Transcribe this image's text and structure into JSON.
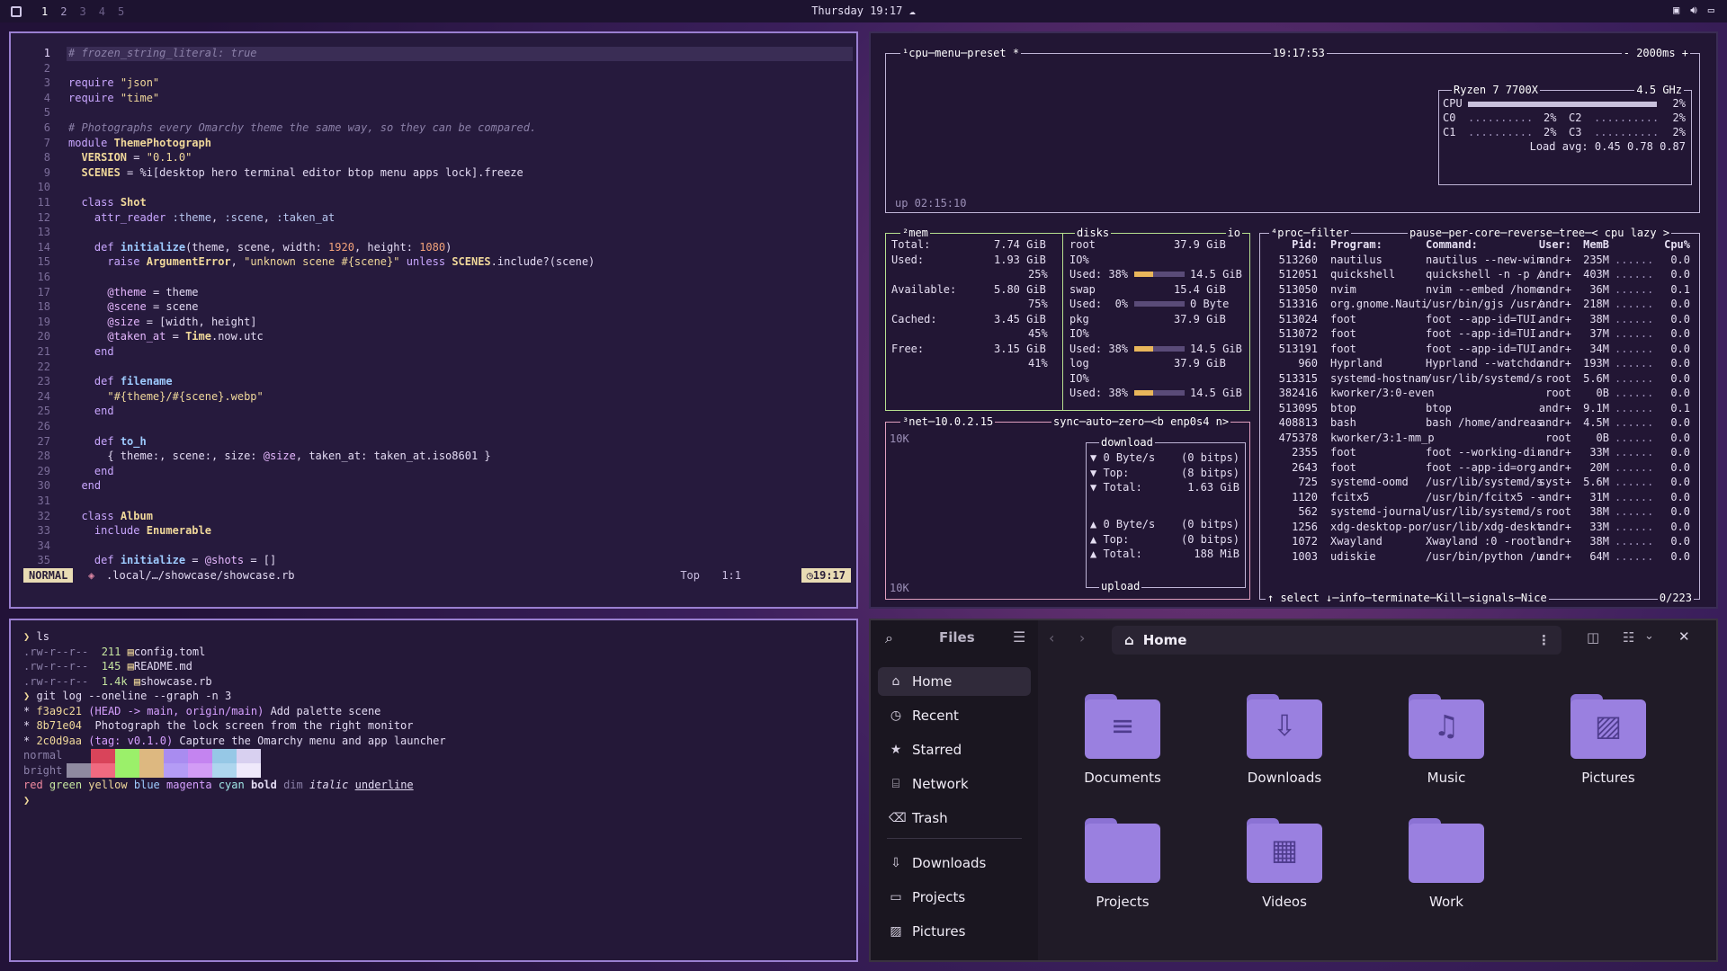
{
  "topbar": {
    "workspaces": [
      "1",
      "2",
      "3",
      "4",
      "5"
    ],
    "clock": "Thursday 19:17",
    "weather_icon": "cloud-icon",
    "tray_icons": [
      "screen-icon",
      "volume-icon",
      "display-icon"
    ]
  },
  "nvim": {
    "lines": [
      {
        "n": "1",
        "code": "# frozen_string_literal: true"
      },
      {
        "n": "2",
        "code": ""
      },
      {
        "n": "3",
        "code": "require \"json\""
      },
      {
        "n": "4",
        "code": "require \"time\""
      },
      {
        "n": "5",
        "code": ""
      },
      {
        "n": "6",
        "code": "# Photographs every Omarchy theme the same way, so they can be compared."
      },
      {
        "n": "7",
        "code": "module ThemePhotograph"
      },
      {
        "n": "8",
        "code": "  VERSION = \"0.1.0\""
      },
      {
        "n": "9",
        "code": "  SCENES = %i[desktop hero terminal editor btop menu apps lock].freeze"
      },
      {
        "n": "10",
        "code": ""
      },
      {
        "n": "11",
        "code": "  class Shot"
      },
      {
        "n": "12",
        "code": "    attr_reader :theme, :scene, :taken_at"
      },
      {
        "n": "13",
        "code": ""
      },
      {
        "n": "14",
        "code": "    def initialize(theme, scene, width: 1920, height: 1080)"
      },
      {
        "n": "15",
        "code": "      raise ArgumentError, \"unknown scene #{scene}\" unless SCENES.include?(scene)"
      },
      {
        "n": "16",
        "code": ""
      },
      {
        "n": "17",
        "code": "      @theme = theme"
      },
      {
        "n": "18",
        "code": "      @scene = scene"
      },
      {
        "n": "19",
        "code": "      @size = [width, height]"
      },
      {
        "n": "20",
        "code": "      @taken_at = Time.now.utc"
      },
      {
        "n": "21",
        "code": "    end"
      },
      {
        "n": "22",
        "code": ""
      },
      {
        "n": "23",
        "code": "    def filename"
      },
      {
        "n": "24",
        "code": "      \"#{theme}/#{scene}.webp\""
      },
      {
        "n": "25",
        "code": "    end"
      },
      {
        "n": "26",
        "code": ""
      },
      {
        "n": "27",
        "code": "    def to_h"
      },
      {
        "n": "28",
        "code": "      { theme:, scene:, size: @size, taken_at: taken_at.iso8601 }"
      },
      {
        "n": "29",
        "code": "    end"
      },
      {
        "n": "30",
        "code": "  end"
      },
      {
        "n": "31",
        "code": ""
      },
      {
        "n": "32",
        "code": "  class Album"
      },
      {
        "n": "33",
        "code": "    include Enumerable"
      },
      {
        "n": "34",
        "code": ""
      },
      {
        "n": "35",
        "code": "    def initialize = @shots = []"
      }
    ],
    "status": {
      "mode": "NORMAL",
      "file": ".local/…/showcase/showcase.rb",
      "scroll": "Top",
      "position": "1:1",
      "time": "19:17"
    }
  },
  "btop": {
    "cpu": {
      "title": "¹cpu",
      "menu": "menu",
      "preset": "preset *",
      "clock": "19:17:53",
      "interval": "- 2000ms +",
      "model": "Ryzen 7 7700X",
      "freq": "4.5 GHz",
      "rows": [
        {
          "label": "CPU",
          "val": "2%"
        },
        {
          "label": "C0",
          "val": "2%"
        },
        {
          "label": "C2",
          "val": "2%"
        },
        {
          "label": "C1",
          "val": "2%"
        },
        {
          "label": "C3",
          "val": "2%"
        }
      ],
      "load": "Load avg: 0.45 0.78 0.87",
      "uptime": "up 02:15:10"
    },
    "mem": {
      "title": "²mem",
      "rows": [
        {
          "label": "Total:",
          "val": "7.74 GiB"
        },
        {
          "label": "Used:",
          "val": "1.93 GiB",
          "pct": "25%"
        },
        {
          "label": "Available:",
          "val": "5.80 GiB",
          "pct": "75%"
        },
        {
          "label": "Cached:",
          "val": "3.45 GiB",
          "pct": "45%"
        },
        {
          "label": "Free:",
          "val": "3.15 GiB",
          "pct": "41%"
        }
      ]
    },
    "disks": {
      "title": "disks",
      "io": "io",
      "rows": [
        {
          "name": "root",
          "size": "37.9 GiB",
          "io": "IO%",
          "used": "Used: 38%",
          "usedval": "14.5 GiB",
          "fill": 0.38
        },
        {
          "name": "swap",
          "size": "15.4 GiB",
          "io": "",
          "used": "Used:  0%",
          "usedval": "0 Byte",
          "fill": 0.0
        },
        {
          "name": "pkg",
          "size": "37.9 GiB",
          "io": "IO%",
          "used": "Used: 38%",
          "usedval": "14.5 GiB",
          "fill": 0.38
        },
        {
          "name": "log",
          "size": "37.9 GiB",
          "io": "IO%",
          "used": "Used: 38%",
          "usedval": "14.5 GiB",
          "fill": 0.38
        }
      ]
    },
    "net": {
      "title": "³net",
      "ip": "10.0.2.15",
      "buttons": [
        "sync",
        "auto",
        "zero",
        "<b enp0s4 n>"
      ],
      "scale_top": "10K",
      "scale_bottom": "10K",
      "download": "download",
      "upload": "upload",
      "dl_rows": [
        {
          "k": "▼ 0 Byte/s",
          "v": "(0 bitps)"
        },
        {
          "k": "▼ Top:",
          "v": "(8 bitps)"
        },
        {
          "k": "▼ Total:",
          "v": "1.63 GiB"
        }
      ],
      "ul_rows": [
        {
          "k": "▲ 0 Byte/s",
          "v": "(0 bitps)"
        },
        {
          "k": "▲ Top:",
          "v": "(0 bitps)"
        },
        {
          "k": "▲ Total:",
          "v": "188 MiB"
        }
      ]
    },
    "proc": {
      "title": "⁴proc",
      "filter": "filter",
      "options": [
        "pause",
        "per-core",
        "reverse",
        "tree",
        "< cpu lazy >"
      ],
      "headers": [
        "Pid:",
        "Program:",
        "Command:",
        "User:",
        "MemB",
        "Cpu%"
      ],
      "rows": [
        [
          "513260",
          "nautilus",
          "nautilus --new-win",
          "andr+",
          "235M",
          "0.0"
        ],
        [
          "512051",
          "quickshell",
          "quickshell -n -p /",
          "andr+",
          "403M",
          "0.0"
        ],
        [
          "513050",
          "nvim",
          "nvim --embed /home",
          "andr+",
          "36M",
          "0.1"
        ],
        [
          "513316",
          "org.gnome.Nauti",
          "/usr/bin/gjs /usr/",
          "andr+",
          "218M",
          "0.0"
        ],
        [
          "513024",
          "foot",
          "foot --app-id=TUI.",
          "andr+",
          "38M",
          "0.0"
        ],
        [
          "513072",
          "foot",
          "foot --app-id=TUI.",
          "andr+",
          "37M",
          "0.0"
        ],
        [
          "513191",
          "foot",
          "foot --app-id=TUI.",
          "andr+",
          "34M",
          "0.0"
        ],
        [
          "960",
          "Hyprland",
          "Hyprland --watchdo",
          "andr+",
          "193M",
          "0.0"
        ],
        [
          "513315",
          "systemd-hostnam",
          "/usr/lib/systemd/s",
          "root",
          "5.6M",
          "0.0"
        ],
        [
          "382416",
          "kworker/3:0-even",
          "",
          "root",
          "0B",
          "0.0"
        ],
        [
          "513095",
          "btop",
          "btop",
          "andr+",
          "9.1M",
          "0.1"
        ],
        [
          "408813",
          "bash",
          "bash /home/andreas",
          "andr+",
          "4.5M",
          "0.0"
        ],
        [
          "475378",
          "kworker/3:1-mm_p",
          "",
          "root",
          "0B",
          "0.0"
        ],
        [
          "2355",
          "foot",
          "foot --working-dir",
          "andr+",
          "33M",
          "0.0"
        ],
        [
          "2643",
          "foot",
          "foot --app-id=org.",
          "andr+",
          "20M",
          "0.0"
        ],
        [
          "725",
          "systemd-oomd",
          "/usr/lib/systemd/s",
          "syst+",
          "5.6M",
          "0.0"
        ],
        [
          "1120",
          "fcitx5",
          "/usr/bin/fcitx5 --",
          "andr+",
          "31M",
          "0.0"
        ],
        [
          "562",
          "systemd-journal",
          "/usr/lib/systemd/s",
          "root",
          "38M",
          "0.0"
        ],
        [
          "1256",
          "xdg-desktop-por",
          "/usr/lib/xdg-deskt",
          "andr+",
          "33M",
          "0.0"
        ],
        [
          "1072",
          "Xwayland",
          "Xwayland :0 -rootl",
          "andr+",
          "38M",
          "0.0"
        ],
        [
          "1003",
          "udiskie",
          "/usr/bin/python /u",
          "andr+",
          "64M",
          "0.0"
        ]
      ],
      "footer": [
        "↑ select ↓",
        "info",
        "terminate",
        "Kill",
        "signals",
        "Nice"
      ],
      "count": "0/223"
    }
  },
  "terminal": {
    "lines": [
      {
        "prompt": "❯",
        "text": "ls"
      },
      {
        "perm": ".rw-r--r--",
        "size": "211",
        "name": "config.toml"
      },
      {
        "perm": ".rw-r--r--",
        "size": "145",
        "name": "README.md"
      },
      {
        "perm": ".rw-r--r--",
        "size": "1.4k",
        "name": "showcase.rb"
      },
      {
        "prompt": "❯",
        "text": "git log --oneline --graph -n 3"
      },
      {
        "hash": "f3a9c21",
        "ref": "(HEAD -> main, origin/main)",
        "msg": "Add palette scene"
      },
      {
        "hash": "8b71e04",
        "ref": "",
        "msg": "Photograph the lock screen from the right monitor"
      },
      {
        "hash": "2c0d9aa",
        "ref": "(tag: v0.1.0)",
        "msg": "Capture the Omarchy menu and app launcher"
      }
    ],
    "normal_label": "normal",
    "bright_label": "bright",
    "normal_colors": [
      "#241838",
      "#d9445a",
      "#9bf06a",
      "#ddb880",
      "#a98cf0",
      "#c484f0",
      "#96c8e6",
      "#d8d0f0"
    ],
    "bright_colors": [
      "#8f8aa0",
      "#f06a80",
      "#9bf06a",
      "#ddb880",
      "#b49cf5",
      "#d29cf5",
      "#aed6ee",
      "#efe9fb"
    ],
    "styles": [
      "red",
      "green",
      "yellow",
      "blue",
      "magenta",
      "cyan",
      "bold",
      "dim",
      "italic",
      "underline"
    ],
    "final_prompt": "❯"
  },
  "files": {
    "title": "Files",
    "path": "Home",
    "sidebar": [
      {
        "label": "Home",
        "icon": "home-icon"
      },
      {
        "label": "Recent",
        "icon": "clock-icon"
      },
      {
        "label": "Starred",
        "icon": "star-icon"
      },
      {
        "label": "Network",
        "icon": "network-icon"
      },
      {
        "label": "Trash",
        "icon": "trash-icon"
      },
      {
        "label": "Downloads",
        "icon": "download-icon"
      },
      {
        "label": "Projects",
        "icon": "folder-icon"
      },
      {
        "label": "Pictures",
        "icon": "image-icon"
      }
    ],
    "folders": [
      {
        "label": "Documents",
        "icon": "document-icon"
      },
      {
        "label": "Downloads",
        "icon": "download-icon"
      },
      {
        "label": "Music",
        "icon": "music-icon"
      },
      {
        "label": "Pictures",
        "icon": "image-icon"
      },
      {
        "label": "Projects",
        "icon": "folder-icon"
      },
      {
        "label": "Videos",
        "icon": "film-icon"
      },
      {
        "label": "Work",
        "icon": "folder-icon"
      }
    ]
  }
}
